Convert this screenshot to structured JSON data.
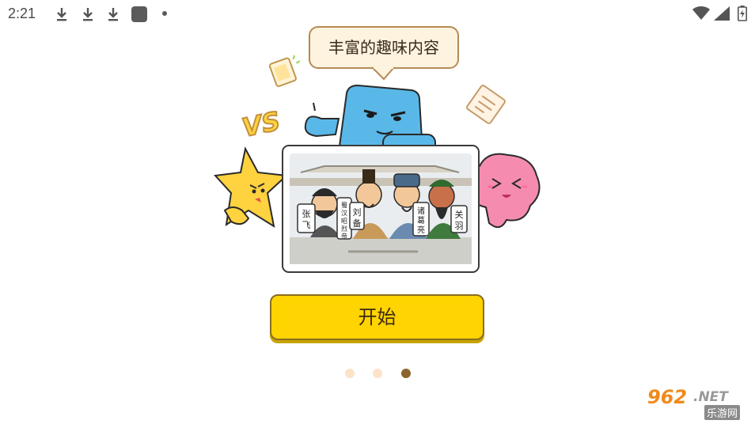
{
  "status_bar": {
    "time": "2:21",
    "icons": [
      "download-icon",
      "download-icon",
      "download-icon",
      "app-notification-icon",
      "dot-icon",
      "wifi-icon",
      "signal-icon",
      "battery-icon"
    ]
  },
  "onboarding": {
    "bubble_text": "丰富的趣味内容",
    "characters": {
      "zhangfei": "张飞",
      "liubei": "刘备",
      "liubei_title": "蜀汉昭烈帝",
      "zhugeliang": "诸葛亮",
      "guanyu": "关羽"
    },
    "vs_badge": "VS",
    "start_button": "开始",
    "page_count": 3,
    "current_page": 3
  },
  "watermark": {
    "main": "962",
    "net": ".NET",
    "sub": "乐游网"
  },
  "colors": {
    "button": "#ffd400",
    "bubble_bg": "#fdf3df",
    "dot_active": "#8d6430",
    "dot_inactive": "#fbe3c9",
    "blue_character": "#5ab8e8",
    "star_character": "#ffd23f",
    "pink_character": "#f58cb0"
  }
}
